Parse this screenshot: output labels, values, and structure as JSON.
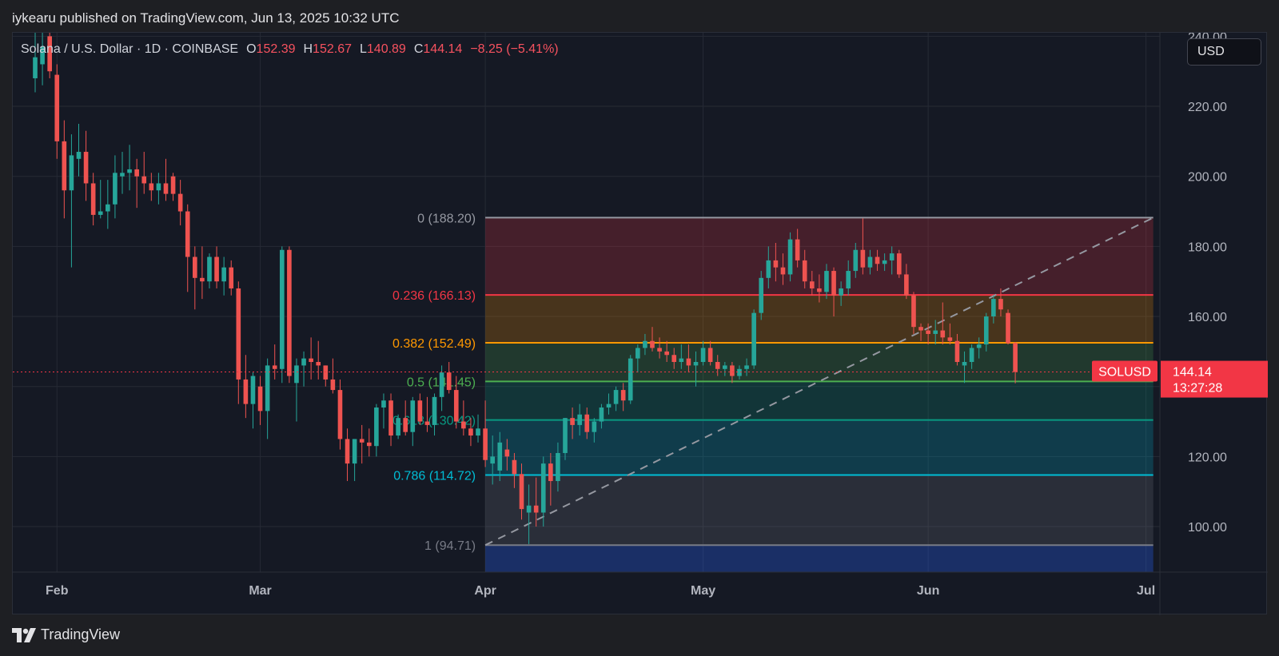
{
  "header": {
    "published_text": "iykearu published on TradingView.com, Jun 13, 2025 10:32 UTC"
  },
  "symbol_bar": {
    "title": "Solana / U.S. Dollar · 1D · COINBASE",
    "open_label": "O",
    "open": "152.39",
    "high_label": "H",
    "high": "152.67",
    "low_label": "L",
    "low": "140.89",
    "close_label": "C",
    "close": "144.14",
    "change": "−8.25 (−5.41%)"
  },
  "currency_button": {
    "label": "USD"
  },
  "footer": {
    "brand": "TradingView"
  },
  "colors": {
    "up": "#26a69a",
    "down": "#ef5350",
    "price_tag": "#f23645",
    "background": "#151924",
    "grid": "#262a35",
    "axis_text": "#b2b5be"
  },
  "chart_data": {
    "type": "candlestick",
    "symbol": "SOLUSD",
    "interval": "1D",
    "x_axis": {
      "ticks": [
        "Feb",
        "Mar",
        "Apr",
        "May",
        "Jun",
        "Jul"
      ],
      "range": [
        "2025-01-29",
        "2025-07-06"
      ]
    },
    "y_axis": {
      "ticks": [
        "100.00",
        "120.00",
        "140.00",
        "160.00",
        "180.00",
        "200.00",
        "220.00",
        "240.00"
      ],
      "range": [
        87,
        241
      ],
      "position": "right"
    },
    "grid": true,
    "last_price": {
      "label": "SOLUSD",
      "value": "144.14",
      "countdown": "13:27:28"
    },
    "fib_retracement": {
      "start_date": "2025-04-01",
      "end_date": "2025-07-02",
      "levels": [
        {
          "ratio": 0,
          "label": "0 (188.20)",
          "price": 188.2,
          "color": "#9598a1"
        },
        {
          "ratio": 0.236,
          "label": "0.236 (166.13)",
          "price": 166.13,
          "color": "#f23645"
        },
        {
          "ratio": 0.382,
          "label": "0.382 (152.49)",
          "price": 152.49,
          "color": "#ff9800"
        },
        {
          "ratio": 0.5,
          "label": "0.5 (141.45)",
          "price": 141.45,
          "color": "#4caf50"
        },
        {
          "ratio": 0.618,
          "label": "0.618 (130.42)",
          "price": 130.42,
          "color": "#089981"
        },
        {
          "ratio": 0.786,
          "label": "0.786 (114.72)",
          "price": 114.72,
          "color": "#00bcd4"
        },
        {
          "ratio": 1,
          "label": "1 (94.71)",
          "price": 94.71,
          "color": "#787b86"
        }
      ],
      "trend_line": {
        "from": [
          "2025-04-01",
          94.71
        ],
        "to": [
          "2025-07-02",
          188.2
        ]
      }
    },
    "candles": [
      {
        "t": "2025-01-29",
        "o": 228,
        "h": 244,
        "l": 224,
        "c": 234
      },
      {
        "t": "2025-01-30",
        "o": 232,
        "h": 243,
        "l": 226,
        "c": 237
      },
      {
        "t": "2025-01-31",
        "o": 240,
        "h": 242,
        "l": 228,
        "c": 230
      },
      {
        "t": "2025-02-01",
        "o": 229,
        "h": 232,
        "l": 205,
        "c": 210
      },
      {
        "t": "2025-02-02",
        "o": 210,
        "h": 216,
        "l": 188,
        "c": 196
      },
      {
        "t": "2025-02-03",
        "o": 196,
        "h": 212,
        "l": 174,
        "c": 206
      },
      {
        "t": "2025-02-04",
        "o": 205,
        "h": 215,
        "l": 200,
        "c": 207
      },
      {
        "t": "2025-02-05",
        "o": 207,
        "h": 213,
        "l": 193,
        "c": 198
      },
      {
        "t": "2025-02-06",
        "o": 198,
        "h": 201,
        "l": 186,
        "c": 189
      },
      {
        "t": "2025-02-07",
        "o": 189,
        "h": 199,
        "l": 188,
        "c": 190
      },
      {
        "t": "2025-02-08",
        "o": 190,
        "h": 199,
        "l": 185,
        "c": 192
      },
      {
        "t": "2025-02-09",
        "o": 192,
        "h": 206,
        "l": 188,
        "c": 201
      },
      {
        "t": "2025-02-10",
        "o": 200,
        "h": 207,
        "l": 195,
        "c": 201
      },
      {
        "t": "2025-02-11",
        "o": 201,
        "h": 209,
        "l": 196,
        "c": 202
      },
      {
        "t": "2025-02-12",
        "o": 202,
        "h": 205,
        "l": 191,
        "c": 200
      },
      {
        "t": "2025-02-13",
        "o": 200,
        "h": 207,
        "l": 195,
        "c": 198
      },
      {
        "t": "2025-02-14",
        "o": 198,
        "h": 201,
        "l": 193,
        "c": 196
      },
      {
        "t": "2025-02-15",
        "o": 196,
        "h": 201,
        "l": 192,
        "c": 198
      },
      {
        "t": "2025-02-16",
        "o": 198,
        "h": 205,
        "l": 193,
        "c": 195
      },
      {
        "t": "2025-02-17",
        "o": 200,
        "h": 201,
        "l": 193,
        "c": 195
      },
      {
        "t": "2025-02-18",
        "o": 195,
        "h": 199,
        "l": 186,
        "c": 190
      },
      {
        "t": "2025-02-19",
        "o": 190,
        "h": 192,
        "l": 167,
        "c": 177
      },
      {
        "t": "2025-02-20",
        "o": 177,
        "h": 180,
        "l": 162,
        "c": 171
      },
      {
        "t": "2025-02-21",
        "o": 171,
        "h": 180,
        "l": 165,
        "c": 170
      },
      {
        "t": "2025-02-22",
        "o": 170,
        "h": 178,
        "l": 168,
        "c": 177
      },
      {
        "t": "2025-02-23",
        "o": 177,
        "h": 180,
        "l": 168,
        "c": 170
      },
      {
        "t": "2025-02-24",
        "o": 170,
        "h": 177,
        "l": 166,
        "c": 174
      },
      {
        "t": "2025-02-25",
        "o": 174,
        "h": 176,
        "l": 166,
        "c": 168
      },
      {
        "t": "2025-02-26",
        "o": 168,
        "h": 170,
        "l": 135,
        "c": 142
      },
      {
        "t": "2025-02-27",
        "o": 142,
        "h": 149,
        "l": 131,
        "c": 135
      },
      {
        "t": "2025-02-28",
        "o": 135,
        "h": 144,
        "l": 128,
        "c": 143
      },
      {
        "t": "2025-03-01",
        "o": 140,
        "h": 143,
        "l": 129,
        "c": 133
      },
      {
        "t": "2025-03-02",
        "o": 133,
        "h": 148,
        "l": 125,
        "c": 146
      },
      {
        "t": "2025-03-03",
        "o": 146,
        "h": 152,
        "l": 142,
        "c": 145
      },
      {
        "t": "2025-03-04",
        "o": 145,
        "h": 180,
        "l": 141,
        "c": 179
      },
      {
        "t": "2025-03-05",
        "o": 179,
        "h": 180,
        "l": 141,
        "c": 143
      },
      {
        "t": "2025-03-06",
        "o": 141,
        "h": 148,
        "l": 130,
        "c": 146
      },
      {
        "t": "2025-03-07",
        "o": 146,
        "h": 150,
        "l": 140,
        "c": 148
      },
      {
        "t": "2025-03-08",
        "o": 148,
        "h": 154,
        "l": 142,
        "c": 147
      },
      {
        "t": "2025-03-09",
        "o": 147,
        "h": 153,
        "l": 142,
        "c": 146
      },
      {
        "t": "2025-03-10",
        "o": 146,
        "h": 146,
        "l": 140,
        "c": 142
      },
      {
        "t": "2025-03-11",
        "o": 142,
        "h": 148,
        "l": 138,
        "c": 139
      },
      {
        "t": "2025-03-12",
        "o": 139,
        "h": 142,
        "l": 122,
        "c": 125
      },
      {
        "t": "2025-03-13",
        "o": 125,
        "h": 128,
        "l": 113,
        "c": 118
      },
      {
        "t": "2025-03-14",
        "o": 118,
        "h": 125,
        "l": 113,
        "c": 125
      },
      {
        "t": "2025-03-15",
        "o": 125,
        "h": 129,
        "l": 118,
        "c": 124
      },
      {
        "t": "2025-03-16",
        "o": 124,
        "h": 128,
        "l": 120,
        "c": 123
      },
      {
        "t": "2025-03-17",
        "o": 123,
        "h": 135,
        "l": 120,
        "c": 134
      },
      {
        "t": "2025-03-18",
        "o": 134,
        "h": 138,
        "l": 128,
        "c": 136
      },
      {
        "t": "2025-03-19",
        "o": 136,
        "h": 138,
        "l": 123,
        "c": 126
      },
      {
        "t": "2025-03-20",
        "o": 126,
        "h": 132,
        "l": 125,
        "c": 131
      },
      {
        "t": "2025-03-21",
        "o": 131,
        "h": 136,
        "l": 126,
        "c": 127
      },
      {
        "t": "2025-03-22",
        "o": 127,
        "h": 137,
        "l": 123,
        "c": 136
      },
      {
        "t": "2025-03-23",
        "o": 136,
        "h": 138,
        "l": 129,
        "c": 130
      },
      {
        "t": "2025-03-24",
        "o": 130,
        "h": 137,
        "l": 127,
        "c": 129
      },
      {
        "t": "2025-03-25",
        "o": 129,
        "h": 138,
        "l": 126,
        "c": 137
      },
      {
        "t": "2025-03-26",
        "o": 137,
        "h": 146,
        "l": 133,
        "c": 144
      },
      {
        "t": "2025-03-27",
        "o": 144,
        "h": 147,
        "l": 138,
        "c": 139
      },
      {
        "t": "2025-03-28",
        "o": 139,
        "h": 143,
        "l": 128,
        "c": 130
      },
      {
        "t": "2025-03-29",
        "o": 130,
        "h": 136,
        "l": 126,
        "c": 128
      },
      {
        "t": "2025-03-30",
        "o": 128,
        "h": 131,
        "l": 123,
        "c": 126
      },
      {
        "t": "2025-03-31",
        "o": 126,
        "h": 132,
        "l": 124,
        "c": 128
      },
      {
        "t": "2025-04-01",
        "o": 128,
        "h": 136,
        "l": 117,
        "c": 119
      },
      {
        "t": "2025-04-02",
        "o": 118,
        "h": 126,
        "l": 112,
        "c": 120
      },
      {
        "t": "2025-04-03",
        "o": 116,
        "h": 127,
        "l": 113,
        "c": 124
      },
      {
        "t": "2025-04-04",
        "o": 122,
        "h": 125,
        "l": 116,
        "c": 120
      },
      {
        "t": "2025-04-05",
        "o": 119,
        "h": 121,
        "l": 111,
        "c": 115
      },
      {
        "t": "2025-04-06",
        "o": 115,
        "h": 118,
        "l": 102,
        "c": 105
      },
      {
        "t": "2025-04-07",
        "o": 104,
        "h": 112,
        "l": 95,
        "c": 106
      },
      {
        "t": "2025-04-08",
        "o": 106,
        "h": 114,
        "l": 100,
        "c": 104
      },
      {
        "t": "2025-04-09",
        "o": 104,
        "h": 120,
        "l": 100,
        "c": 118
      },
      {
        "t": "2025-04-10",
        "o": 118,
        "h": 121,
        "l": 106,
        "c": 113
      },
      {
        "t": "2025-04-11",
        "o": 113,
        "h": 124,
        "l": 110,
        "c": 121
      },
      {
        "t": "2025-04-12",
        "o": 121,
        "h": 131,
        "l": 119,
        "c": 131
      },
      {
        "t": "2025-04-13",
        "o": 131,
        "h": 134,
        "l": 125,
        "c": 129
      },
      {
        "t": "2025-04-14",
        "o": 129,
        "h": 135,
        "l": 126,
        "c": 132
      },
      {
        "t": "2025-04-15",
        "o": 132,
        "h": 134,
        "l": 125,
        "c": 127
      },
      {
        "t": "2025-04-16",
        "o": 127,
        "h": 131,
        "l": 124,
        "c": 130
      },
      {
        "t": "2025-04-17",
        "o": 130,
        "h": 135,
        "l": 128,
        "c": 134
      },
      {
        "t": "2025-04-18",
        "o": 134,
        "h": 138,
        "l": 132,
        "c": 135
      },
      {
        "t": "2025-04-19",
        "o": 135,
        "h": 140,
        "l": 133,
        "c": 139
      },
      {
        "t": "2025-04-20",
        "o": 139,
        "h": 141,
        "l": 133,
        "c": 136
      },
      {
        "t": "2025-04-21",
        "o": 136,
        "h": 149,
        "l": 135,
        "c": 148
      },
      {
        "t": "2025-04-22",
        "o": 148,
        "h": 152,
        "l": 144,
        "c": 151
      },
      {
        "t": "2025-04-23",
        "o": 151,
        "h": 155,
        "l": 149,
        "c": 153
      },
      {
        "t": "2025-04-24",
        "o": 153,
        "h": 157,
        "l": 150,
        "c": 151
      },
      {
        "t": "2025-04-25",
        "o": 151,
        "h": 154,
        "l": 148,
        "c": 150
      },
      {
        "t": "2025-04-26",
        "o": 150,
        "h": 153,
        "l": 147,
        "c": 149
      },
      {
        "t": "2025-04-27",
        "o": 149,
        "h": 151,
        "l": 145,
        "c": 147
      },
      {
        "t": "2025-04-28",
        "o": 147,
        "h": 152,
        "l": 145,
        "c": 148
      },
      {
        "t": "2025-04-29",
        "o": 148,
        "h": 152,
        "l": 144,
        "c": 146
      },
      {
        "t": "2025-04-30",
        "o": 146,
        "h": 150,
        "l": 140,
        "c": 147
      },
      {
        "t": "2025-05-01",
        "o": 147,
        "h": 153,
        "l": 146,
        "c": 151
      },
      {
        "t": "2025-05-02",
        "o": 151,
        "h": 153,
        "l": 146,
        "c": 147
      },
      {
        "t": "2025-05-03",
        "o": 147,
        "h": 149,
        "l": 143,
        "c": 145
      },
      {
        "t": "2025-05-04",
        "o": 145,
        "h": 147,
        "l": 143,
        "c": 146
      },
      {
        "t": "2025-05-05",
        "o": 146,
        "h": 147,
        "l": 141,
        "c": 143
      },
      {
        "t": "2025-05-06",
        "o": 143,
        "h": 146,
        "l": 142,
        "c": 145
      },
      {
        "t": "2025-05-07",
        "o": 145,
        "h": 148,
        "l": 143,
        "c": 146
      },
      {
        "t": "2025-05-08",
        "o": 146,
        "h": 162,
        "l": 145,
        "c": 161
      },
      {
        "t": "2025-05-09",
        "o": 161,
        "h": 173,
        "l": 159,
        "c": 171
      },
      {
        "t": "2025-05-10",
        "o": 171,
        "h": 180,
        "l": 168,
        "c": 176
      },
      {
        "t": "2025-05-11",
        "o": 176,
        "h": 181,
        "l": 170,
        "c": 174
      },
      {
        "t": "2025-05-12",
        "o": 174,
        "h": 178,
        "l": 169,
        "c": 172
      },
      {
        "t": "2025-05-13",
        "o": 172,
        "h": 184,
        "l": 170,
        "c": 182
      },
      {
        "t": "2025-05-14",
        "o": 182,
        "h": 185,
        "l": 174,
        "c": 176
      },
      {
        "t": "2025-05-15",
        "o": 176,
        "h": 179,
        "l": 168,
        "c": 170
      },
      {
        "t": "2025-05-16",
        "o": 170,
        "h": 173,
        "l": 166,
        "c": 168
      },
      {
        "t": "2025-05-17",
        "o": 168,
        "h": 172,
        "l": 164,
        "c": 167
      },
      {
        "t": "2025-05-18",
        "o": 167,
        "h": 175,
        "l": 165,
        "c": 173
      },
      {
        "t": "2025-05-19",
        "o": 173,
        "h": 174,
        "l": 160,
        "c": 166
      },
      {
        "t": "2025-05-20",
        "o": 166,
        "h": 170,
        "l": 163,
        "c": 168
      },
      {
        "t": "2025-05-21",
        "o": 168,
        "h": 176,
        "l": 166,
        "c": 173
      },
      {
        "t": "2025-05-22",
        "o": 173,
        "h": 181,
        "l": 171,
        "c": 179
      },
      {
        "t": "2025-05-23",
        "o": 179,
        "h": 188,
        "l": 172,
        "c": 174
      },
      {
        "t": "2025-05-24",
        "o": 174,
        "h": 179,
        "l": 172,
        "c": 177
      },
      {
        "t": "2025-05-25",
        "o": 177,
        "h": 179,
        "l": 173,
        "c": 175
      },
      {
        "t": "2025-05-26",
        "o": 175,
        "h": 178,
        "l": 173,
        "c": 176
      },
      {
        "t": "2025-05-27",
        "o": 176,
        "h": 180,
        "l": 172,
        "c": 178
      },
      {
        "t": "2025-05-28",
        "o": 178,
        "h": 179,
        "l": 171,
        "c": 172
      },
      {
        "t": "2025-05-29",
        "o": 172,
        "h": 175,
        "l": 165,
        "c": 166
      },
      {
        "t": "2025-05-30",
        "o": 166,
        "h": 167,
        "l": 155,
        "c": 157
      },
      {
        "t": "2025-05-31",
        "o": 157,
        "h": 158,
        "l": 153,
        "c": 156
      },
      {
        "t": "2025-06-01",
        "o": 156,
        "h": 158,
        "l": 152,
        "c": 155
      },
      {
        "t": "2025-06-02",
        "o": 155,
        "h": 159,
        "l": 152,
        "c": 156
      },
      {
        "t": "2025-06-03",
        "o": 156,
        "h": 164,
        "l": 152,
        "c": 154
      },
      {
        "t": "2025-06-04",
        "o": 154,
        "h": 158,
        "l": 152,
        "c": 153
      },
      {
        "t": "2025-06-05",
        "o": 153,
        "h": 155,
        "l": 146,
        "c": 147
      },
      {
        "t": "2025-06-06",
        "o": 146,
        "h": 150,
        "l": 141,
        "c": 147
      },
      {
        "t": "2025-06-07",
        "o": 147,
        "h": 152,
        "l": 145,
        "c": 151
      },
      {
        "t": "2025-06-08",
        "o": 151,
        "h": 154,
        "l": 148,
        "c": 152
      },
      {
        "t": "2025-06-09",
        "o": 152,
        "h": 161,
        "l": 150,
        "c": 160
      },
      {
        "t": "2025-06-10",
        "o": 160,
        "h": 166,
        "l": 158,
        "c": 165
      },
      {
        "t": "2025-06-11",
        "o": 165,
        "h": 168,
        "l": 160,
        "c": 162
      },
      {
        "t": "2025-06-12",
        "o": 161,
        "h": 162,
        "l": 152,
        "c": 152.39
      },
      {
        "t": "2025-06-13",
        "o": 152.39,
        "h": 152.67,
        "l": 140.89,
        "c": 144.14
      }
    ]
  }
}
